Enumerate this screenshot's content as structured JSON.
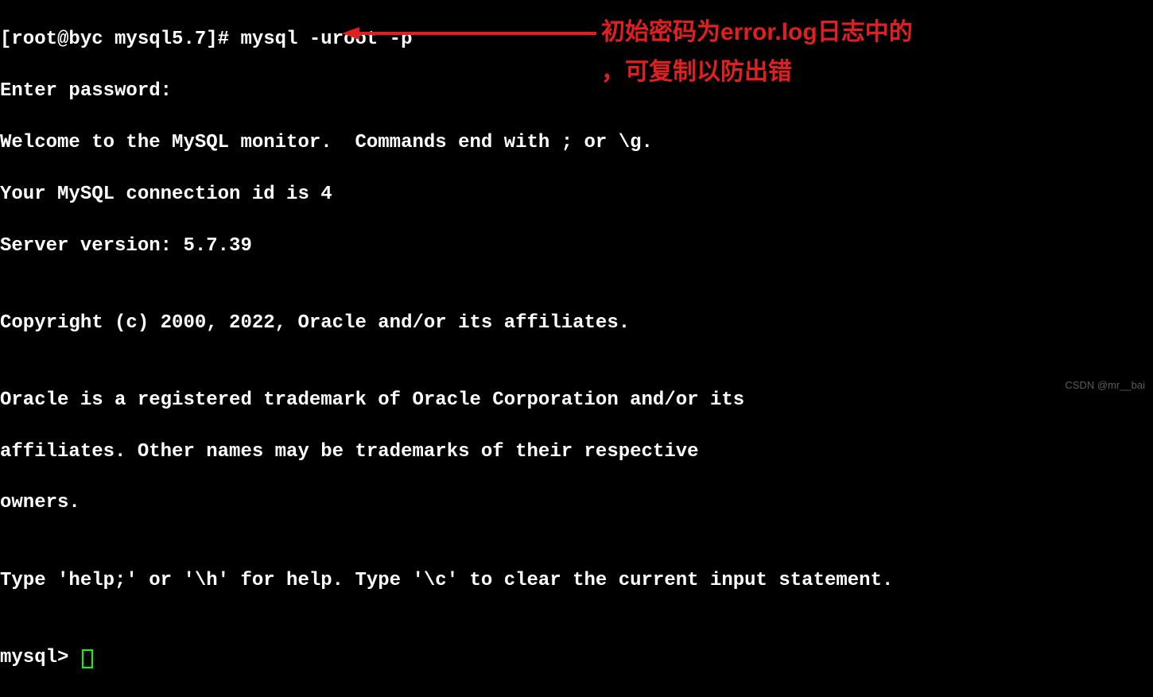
{
  "terminal": {
    "prompt": "[root@byc mysql5.7]# ",
    "command": "mysql -uroot -p",
    "lines": [
      "Enter password:",
      "Welcome to the MySQL monitor.  Commands end with ; or \\g.",
      "Your MySQL connection id is 4",
      "Server version: 5.7.39",
      "",
      "Copyright (c) 2000, 2022, Oracle and/or its affiliates.",
      "",
      "Oracle is a registered trademark of Oracle Corporation and/or its",
      "affiliates. Other names may be trademarks of their respective",
      "owners.",
      "",
      "Type 'help;' or '\\h' for help. Type '\\c' to clear the current input statement.",
      ""
    ],
    "mysql_prompt": "mysql> "
  },
  "annotation": {
    "line1": "初始密码为error.log日志中的",
    "line2": "，可复制以防出错",
    "arrow_color": "#e02020"
  },
  "watermark": "CSDN @mr__bai"
}
